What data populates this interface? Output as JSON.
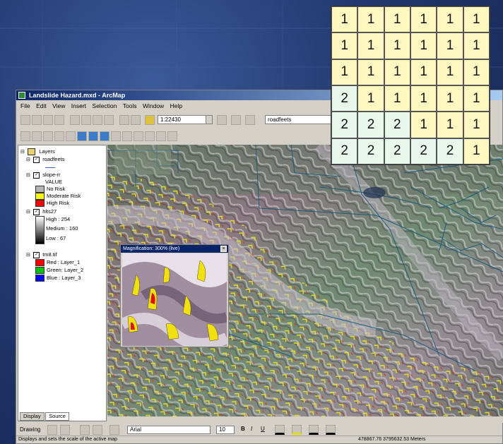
{
  "window": {
    "title": "Landslide Hazard.mxd - ArcMap",
    "menu": [
      "File",
      "Edit",
      "View",
      "Insert",
      "Selection",
      "Tools",
      "Window",
      "Help"
    ],
    "scale": "1:22430",
    "target_layer": "roadfeets"
  },
  "toc": {
    "root": "Layers",
    "layers": [
      {
        "name": "roadfeets"
      },
      {
        "name": "slope-rr",
        "legend_heading": "VALUE",
        "classes": [
          {
            "label": "No Risk",
            "color": "#b4b4b4"
          },
          {
            "label": "Moderate Risk",
            "color": "#ffff00"
          },
          {
            "label": "High Risk",
            "color": "#ff0000"
          }
        ]
      },
      {
        "name": "hlts27",
        "stretch": {
          "high": "High : 254",
          "medium": "Medium : 160",
          "low": "Low : 67"
        }
      },
      {
        "name": "tm8.tif",
        "bands": [
          {
            "label": "Red : Layer_1",
            "color": "#ff0000"
          },
          {
            "label": "Green: Layer_2",
            "color": "#00c000"
          },
          {
            "label": "Blue : Layer_3",
            "color": "#0000ff"
          }
        ]
      }
    ],
    "tabs": [
      "Display",
      "Source"
    ]
  },
  "magnifier": {
    "title": "Magnification: 300% (live)",
    "close": "×"
  },
  "drawing_toolbar": {
    "label": "Drawing",
    "font": "Arial",
    "size": "10",
    "bold": "B",
    "italic": "I",
    "underline": "U"
  },
  "status": {
    "message": "Displays and sets the scale of the active map",
    "coords": "478867.76  3795632.53 Meters"
  },
  "grid": {
    "rows": [
      [
        1,
        1,
        1,
        1,
        1,
        1
      ],
      [
        1,
        1,
        1,
        1,
        1,
        1
      ],
      [
        1,
        1,
        1,
        1,
        1,
        1
      ],
      [
        2,
        1,
        1,
        1,
        1,
        1
      ],
      [
        2,
        2,
        2,
        1,
        1,
        1
      ],
      [
        2,
        2,
        2,
        2,
        2,
        1
      ]
    ],
    "colors": {
      "1": "#fff8c0",
      "2": "#e8f8ec"
    }
  }
}
